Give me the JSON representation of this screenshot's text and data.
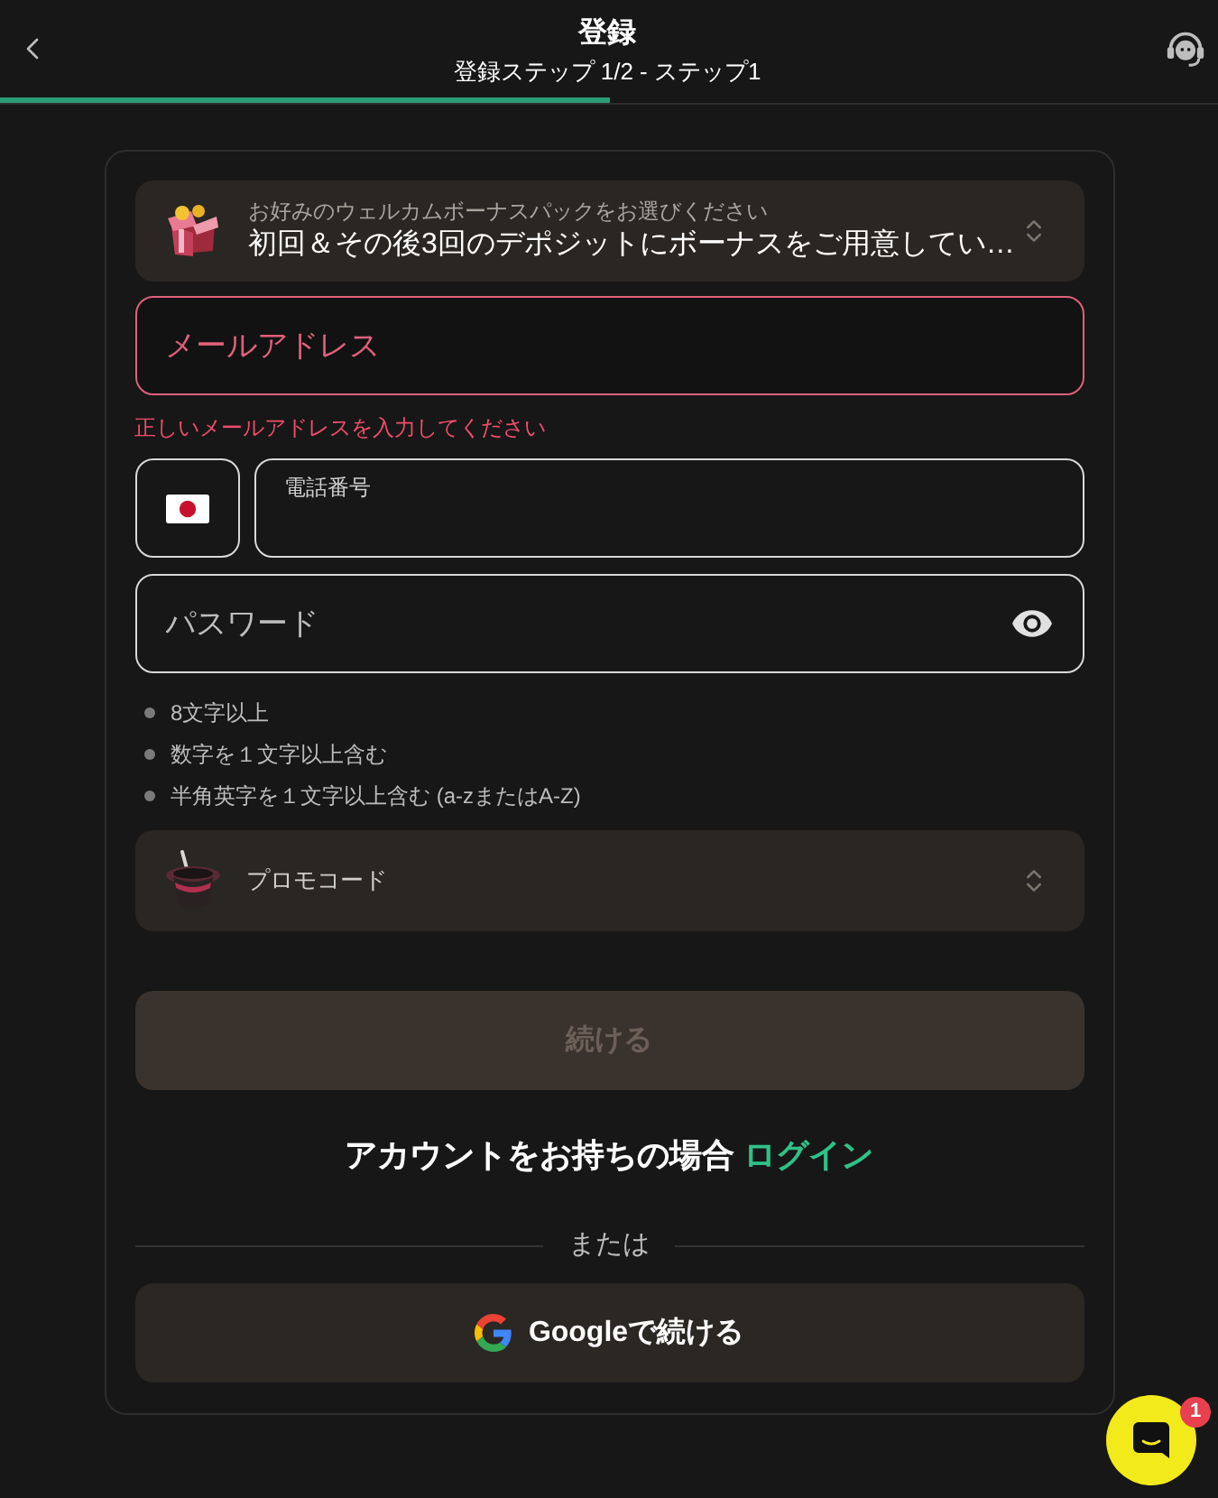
{
  "header": {
    "title": "登録",
    "subtitle": "登録ステップ 1/2 - ステップ1",
    "progress": {
      "level": 0.5
    }
  },
  "form": {
    "bonus_select": {
      "label": "お好みのウェルカムボーナスパックをお選びください",
      "value": "初回＆その後3回のデポジットにボーナスをご用意してい…"
    },
    "email": {
      "placeholder": "メールアドレス",
      "invalid": true,
      "error": "正しいメールアドレスを入力してください"
    },
    "phone": {
      "label": "電話番号"
    },
    "password": {
      "placeholder": "パスワード"
    },
    "password_rules": [
      {
        "text": "8文字以上",
        "met": false
      },
      {
        "text": "数字を１文字以上含む",
        "met": false
      },
      {
        "text": "半角英字を１文字以上含む (a-zまたはA-Z)",
        "met": false
      }
    ],
    "promo_select": {
      "placeholder": "プロモコード"
    },
    "continue_button": {
      "label": "続ける",
      "disabled": true
    },
    "login_prompt": {
      "text": "アカウントをお持ちの場合",
      "link": "ログイン"
    },
    "divider": "または",
    "google_button": {
      "label": "Googleで続ける"
    }
  },
  "chat_button": {
    "badge": "1"
  }
}
